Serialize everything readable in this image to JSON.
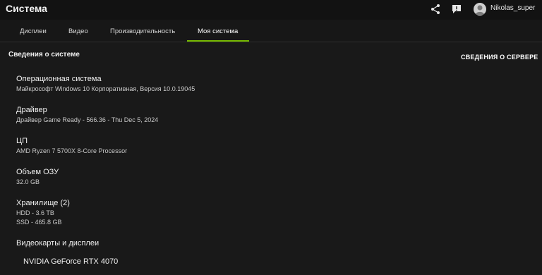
{
  "app": {
    "title": "Система",
    "username": "Nikolas_super"
  },
  "tabs": [
    {
      "label": "Дисплеи"
    },
    {
      "label": "Видео"
    },
    {
      "label": "Производительность"
    },
    {
      "label": "Моя система"
    }
  ],
  "main": {
    "section_title": "Сведения о системе",
    "server_link": "СВЕДЕНИЯ О СЕРВЕРЕ",
    "os": {
      "label": "Операционная система",
      "value": "Майкрософт Windows 10 Корпоративная, Версия 10.0.19045"
    },
    "driver": {
      "label": "Драйвер",
      "value": "Драйвер Game Ready - 566.36 - Thu Dec 5, 2024"
    },
    "cpu": {
      "label": "ЦП",
      "value": "AMD Ryzen 7 5700X 8-Core Processor"
    },
    "ram": {
      "label": "Объем ОЗУ",
      "value": "32.0 GB"
    },
    "storage": {
      "label": "Хранилище (2)",
      "values": [
        "HDD - 3.6 TB",
        "SSD - 465.8 GB"
      ]
    },
    "gpus": {
      "label": "Видеокарты и дисплеи",
      "items": [
        "NVIDIA GeForce RTX 4070"
      ]
    }
  },
  "icons": {
    "share": "share-icon",
    "notifications": "notification-icon",
    "avatar": "user-avatar-icon"
  },
  "colors": {
    "accent": "#76b900",
    "background": "#191919",
    "titlebar": "#121212"
  }
}
